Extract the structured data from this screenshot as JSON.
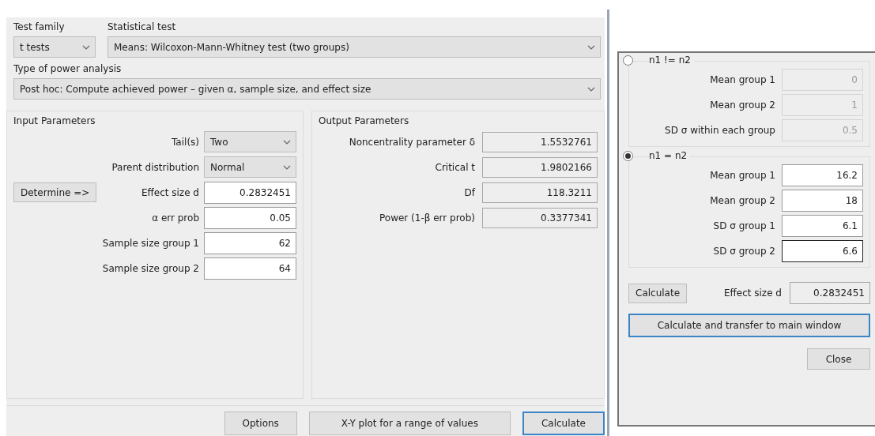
{
  "test_family": {
    "label": "Test family",
    "value": "t tests"
  },
  "statistical_test": {
    "label": "Statistical test",
    "value": "Means: Wilcoxon-Mann-Whitney test (two groups)"
  },
  "power_analysis": {
    "label": "Type of power analysis",
    "value": "Post hoc: Compute achieved power – given α, sample size, and effect size"
  },
  "input_parameters": {
    "title": "Input Parameters",
    "determine_button": "Determine =>",
    "fields": [
      {
        "kind": "select",
        "label": "Tail(s)",
        "value": "Two"
      },
      {
        "kind": "select",
        "label": "Parent distribution",
        "value": "Normal"
      },
      {
        "kind": "input",
        "label": "Effect size d",
        "value": "0.2832451"
      },
      {
        "kind": "input",
        "label": "α err prob",
        "value": "0.05"
      },
      {
        "kind": "input",
        "label": "Sample size group 1",
        "value": "62"
      },
      {
        "kind": "input",
        "label": "Sample size group 2",
        "value": "64"
      }
    ]
  },
  "output_parameters": {
    "title": "Output Parameters",
    "fields": [
      {
        "label": "Noncentrality parameter δ",
        "value": "1.5532761"
      },
      {
        "label": "Critical t",
        "value": "1.9802166"
      },
      {
        "label": "Df",
        "value": "118.3211"
      },
      {
        "label": "Power (1-β err prob)",
        "value": "0.3377341"
      }
    ]
  },
  "buttons": [
    {
      "label": "Options",
      "focused": false
    },
    {
      "label": "X-Y plot for a range of values",
      "focused": false
    },
    {
      "label": "Calculate",
      "focused": true
    }
  ],
  "effect_size_dialog": {
    "options": [
      {
        "label": "n1 != n2",
        "selected": false,
        "fields": [
          {
            "label": "Mean group 1",
            "value": "0",
            "focused": false
          },
          {
            "label": "Mean group 2",
            "value": "1",
            "focused": false
          },
          {
            "label": "SD σ within each group",
            "value": "0.5",
            "focused": false
          }
        ]
      },
      {
        "label": "n1 = n2",
        "selected": true,
        "fields": [
          {
            "label": "Mean group 1",
            "value": "16.2",
            "focused": false
          },
          {
            "label": "Mean group 2",
            "value": "18",
            "focused": false
          },
          {
            "label": "SD σ group 1",
            "value": "6.1",
            "focused": false
          },
          {
            "label": "SD σ group 2",
            "value": "6.6",
            "focused": true
          }
        ]
      }
    ],
    "calculate_button": "Calculate",
    "effect_size": {
      "label": "Effect size d",
      "value": "0.2832451"
    },
    "transfer_button": {
      "label": "Calculate and transfer to main window",
      "focused": true
    },
    "close_button": "Close"
  }
}
